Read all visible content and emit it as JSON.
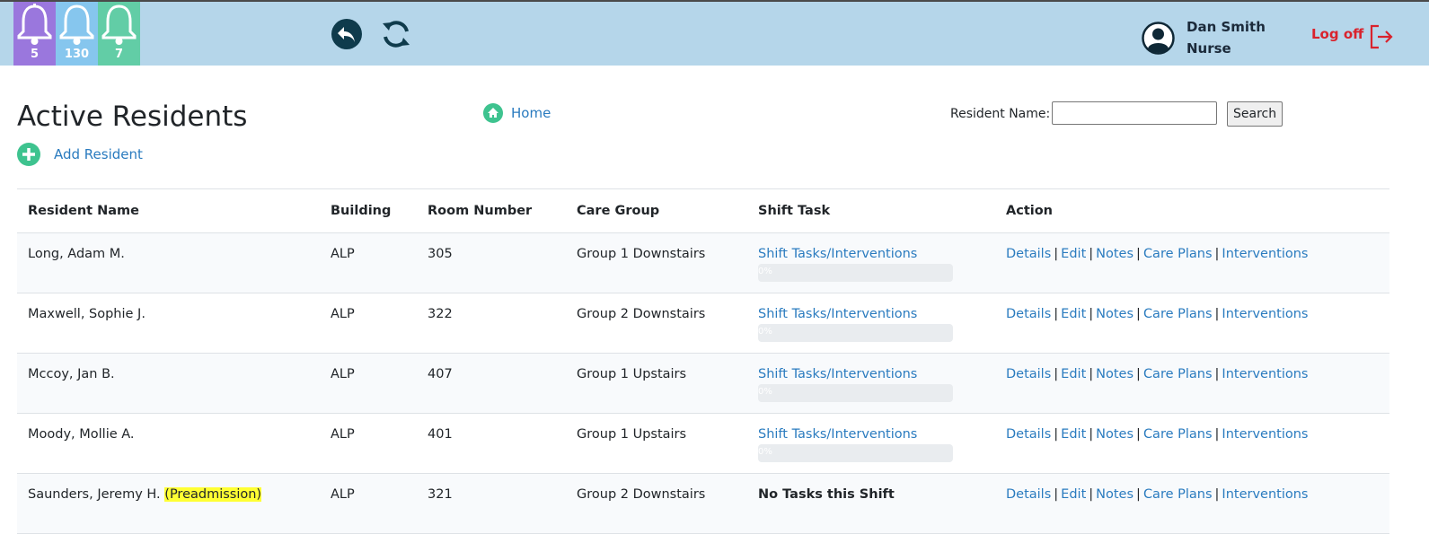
{
  "notifications": [
    {
      "count": "5",
      "color": "#9a77dd"
    },
    {
      "count": "130",
      "color": "#86c6ee"
    },
    {
      "count": "7",
      "color": "#62cda6"
    }
  ],
  "user": {
    "name": "Dan Smith",
    "role": "Nurse",
    "logoff_label": "Log off"
  },
  "page": {
    "title": "Active Residents",
    "add_label": "Add Resident",
    "home_label": "Home"
  },
  "search": {
    "label": "Resident Name:",
    "value": "",
    "button_label": "Search"
  },
  "table": {
    "headers": [
      "Resident Name",
      "Building",
      "Room Number",
      "Care Group",
      "Shift Task",
      "Action"
    ],
    "actions": [
      "Details",
      "Edit",
      "Notes",
      "Care Plans",
      "Interventions"
    ],
    "rows": [
      {
        "name": "Long, Adam M.",
        "building": "ALP",
        "room": "305",
        "group": "Group 1 Downstairs",
        "task": "Shift Tasks/Interventions",
        "progress": "0%"
      },
      {
        "name": "Maxwell, Sophie J.",
        "building": "ALP",
        "room": "322",
        "group": "Group 2 Downstairs",
        "task": "Shift Tasks/Interventions",
        "progress": "0%"
      },
      {
        "name": "Mccoy, Jan B.",
        "building": "ALP",
        "room": "407",
        "group": "Group 1 Upstairs",
        "task": "Shift Tasks/Interventions",
        "progress": "0%"
      },
      {
        "name": "Moody, Mollie A.",
        "building": "ALP",
        "room": "401",
        "group": "Group 1 Upstairs",
        "task": "Shift Tasks/Interventions",
        "progress": "0%"
      },
      {
        "name": "Saunders, Jeremy H.",
        "tag": "(Preadmission)",
        "building": "ALP",
        "room": "321",
        "group": "Group 2 Downstairs",
        "no_task": "No Tasks this Shift"
      }
    ]
  }
}
